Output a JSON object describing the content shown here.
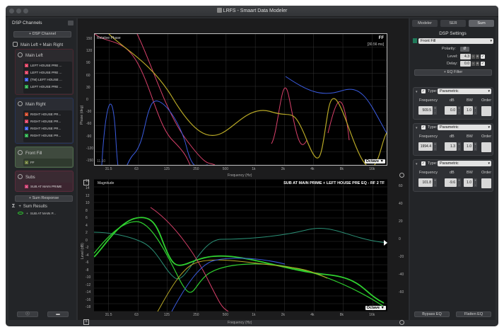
{
  "window": {
    "title": "LRFS - Smaart Data Modeler"
  },
  "left": {
    "header": "DSP Channels",
    "add_channel": "+ DSP Channel",
    "main_pair": "Main Left + Main Right",
    "main_left": {
      "label": "Main Left",
      "items": [
        "LEFT HOUSE PRE ...",
        "LEFT HOUSE PRE ...",
        "(TM) LEFT HOUSE ...",
        "LEFT HOUSE PRE ..."
      ]
    },
    "main_right": {
      "label": "Main Right",
      "items": [
        "RIGHT HOUSE PR...",
        "RIGHT HOUSE PR...",
        "RIGHT HOUSE PR...",
        "RIGHT HOUSE PR..."
      ]
    },
    "front_fill": {
      "label": "Front Fill",
      "items": [
        "FF"
      ]
    },
    "subs": {
      "label": "Subs",
      "items": [
        "SUB AT MAIN PRIME"
      ]
    },
    "add_sum": "+ Sum Response",
    "sum_results": "Sum Results",
    "sum_item": "SUB AT MAIN P...",
    "sigma": "Σ",
    "plus": "+"
  },
  "phase": {
    "title": "Relative Phase",
    "trace_name": "FF",
    "delay": "[30.56 ms]",
    "ylabel": "Phase (deg)",
    "xlabel": "Frequency (Hz)",
    "octave": "Octave",
    "corner_value": "11.10",
    "yticks": [
      "150",
      "120",
      "90",
      "60",
      "30",
      "0",
      "-30",
      "-60",
      "-90",
      "-120",
      "-150"
    ],
    "xticks": [
      "31.5",
      "63",
      "125",
      "250",
      "500",
      "1k",
      "2k",
      "4k",
      "8k",
      "16k"
    ]
  },
  "mag": {
    "title": "Magnitude",
    "trace_name": "SUB AT MAIN PRIME + LEFT HOUSE PRE EQ - RF 2 TF",
    "ylabel": "Level (dB)",
    "xlabel": "Frequency (Hz)",
    "octave": "Octave",
    "yticks_left": [
      "16",
      "14",
      "12",
      "10",
      "8",
      "6",
      "4",
      "2",
      "0",
      "-2",
      "-4",
      "-6",
      "-8",
      "-10",
      "-12",
      "-14",
      "-16",
      "-18"
    ],
    "yticks_right": [
      "60",
      "40",
      "20",
      "0",
      "-20",
      "-40",
      "-60"
    ],
    "xticks": [
      "31.5",
      "63",
      "125",
      "250",
      "500",
      "1k",
      "2k",
      "4k",
      "8k",
      "16k"
    ]
  },
  "right": {
    "tabs": [
      "Modeler",
      "SER",
      "Sum"
    ],
    "settings_title": "DSP Settings",
    "channel": "Front Fill",
    "polarity_label": "Polarity:",
    "polarity_symbol": "Ø",
    "level_label": "Level:",
    "level_value": "4.3",
    "delay_label": "Delay:",
    "delay_value": "0.0",
    "add_eq": "+ EQ Filter",
    "filters": [
      {
        "type": "Parametric",
        "frequency": "509.5",
        "db": "0.0",
        "bw": "1.0"
      },
      {
        "type": "Parametric",
        "frequency": "1994.4",
        "db": "1.3",
        "bw": "1.0"
      },
      {
        "type": "Parametric",
        "frequency": "101.8",
        "db": "-9.6",
        "bw": "1.0"
      }
    ],
    "type_label": "Type:",
    "col_labels": [
      "Frequency",
      "dB",
      "BW",
      "Order"
    ],
    "bypass_eq": "Bypass EQ",
    "flatten_eq": "Flatten EQ"
  },
  "colors": {
    "accent": "#1f7a5a",
    "yellow": "#b8a826",
    "blue": "#3b5ce0",
    "pink": "#d8406a",
    "green": "#2fd02f",
    "teal": "#2a8f75"
  }
}
